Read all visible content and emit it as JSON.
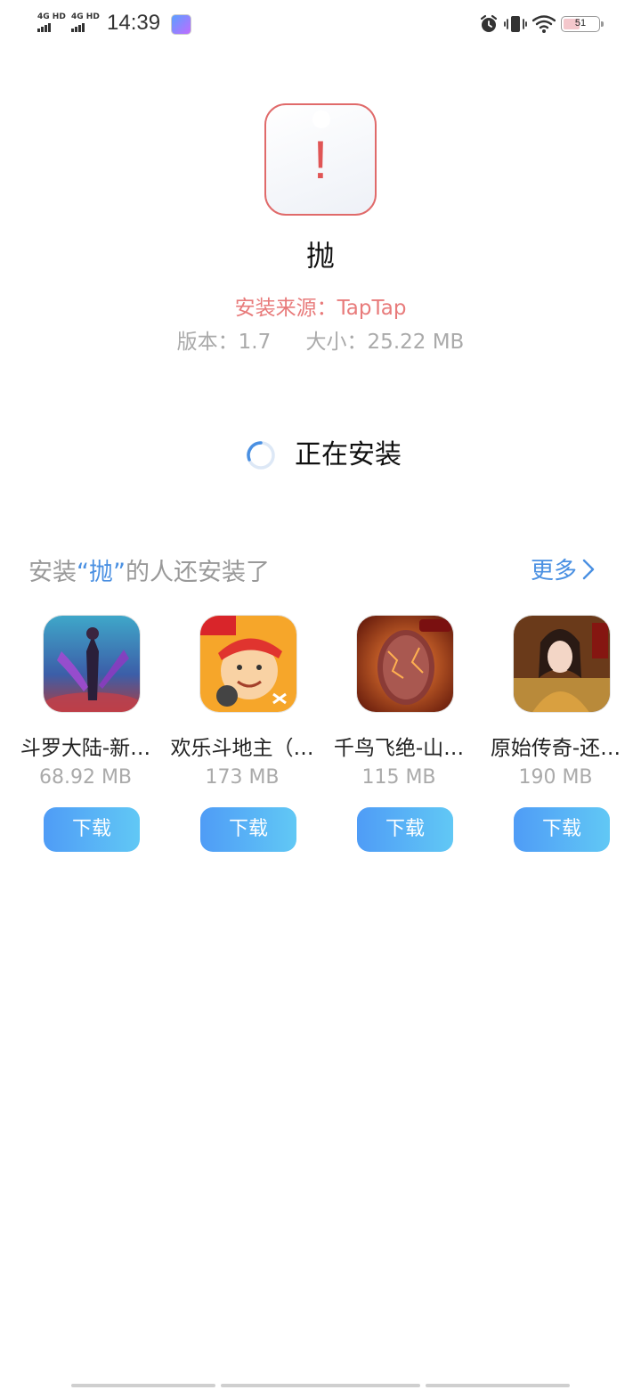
{
  "status_bar": {
    "signal1": "4G HD",
    "signal2": "4G HD",
    "time": "14:39",
    "battery": "51",
    "icons": [
      "alarm-icon",
      "vibrate-icon",
      "wifi-icon",
      "battery-icon"
    ]
  },
  "app": {
    "icon": "warning-icon",
    "name": "抛",
    "source": "安装来源：TapTap",
    "version": "版本：1.7",
    "size": "大小：25.22 MB"
  },
  "install": {
    "status": "正在安装"
  },
  "recommend": {
    "title_prefix": "安装",
    "title_quote": "“抛”",
    "title_suffix": "的人还安装了",
    "more": "更多",
    "apps": [
      {
        "name": "斗罗大陆-新…",
        "size": "68.92 MB",
        "button": "下载"
      },
      {
        "name": "欢乐斗地主（…",
        "size": "173 MB",
        "button": "下载"
      },
      {
        "name": "千鸟飞绝-山…",
        "size": "115 MB",
        "button": "下载"
      },
      {
        "name": "原始传奇-还…",
        "size": "190 MB",
        "button": "下载"
      }
    ]
  },
  "colors": {
    "accent": "#4a90e2",
    "source_red": "#e87b7b",
    "button_start": "#4f9cf6",
    "button_end": "#61c8f5"
  }
}
